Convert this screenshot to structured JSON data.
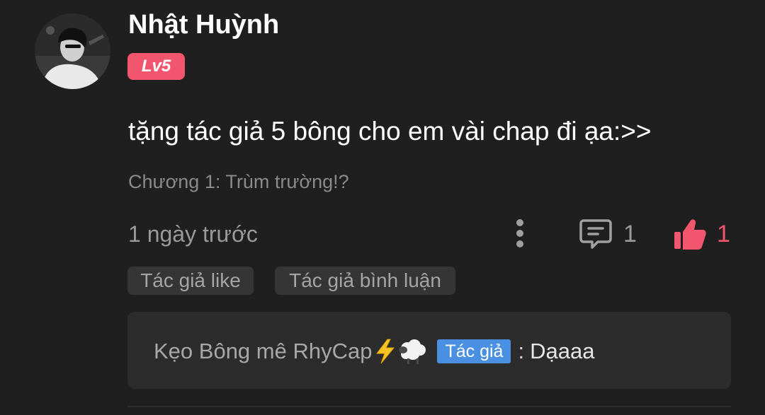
{
  "comment": {
    "author": {
      "name": "Nhật Huỳnh",
      "level": "Lv5",
      "avatar_icon": "user-avatar-photo"
    },
    "text": "tặng tác giả 5 bông cho em vài chap đi ạa:>>",
    "chapter": "Chương 1: Trùm trường!?",
    "timestamp": "1 ngày trước",
    "actions": {
      "more_icon": "vertical-dots-icon",
      "reply_icon": "comment-icon",
      "reply_count": "1",
      "like_icon": "thumbs-up-icon",
      "like_count": "1"
    },
    "tags": {
      "author_like": "Tác giả like",
      "author_reply": "Tác giả bình luận"
    },
    "reply": {
      "author": "Kẹo Bông mê RhyCap",
      "emoji": [
        "lightning-icon",
        "sheep-icon"
      ],
      "badge": "Tác giả",
      "separator": ":",
      "text": "Dạaaa"
    }
  },
  "colors": {
    "background": "#1f1f1f",
    "accent_pink": "#f2566e",
    "badge_blue": "#4a90e2",
    "muted_text": "#9a9a9a",
    "reply_box": "#2c2c2c",
    "tag_bg": "#353535"
  }
}
